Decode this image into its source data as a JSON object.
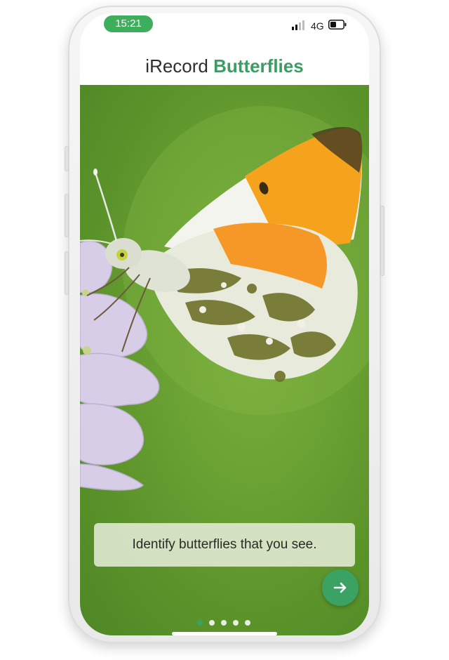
{
  "status_bar": {
    "time": "15:21",
    "network": "4G",
    "signal_icon": "cell-signal-icon",
    "battery_icon": "battery-icon"
  },
  "header": {
    "app_name": "iRecord",
    "app_name_accent": "Butterflies"
  },
  "slide": {
    "image": "orange-tip-butterfly-on-flower-photo",
    "caption": "Identify butterflies that you see.",
    "next_icon": "arrow-right-icon"
  },
  "pager": {
    "total": 5,
    "active_index": 0
  },
  "colors": {
    "brand_green": "#3d9c63",
    "button_green": "#3aa363",
    "time_pill_green": "#3fae5c",
    "background_green": "#6ba234"
  }
}
